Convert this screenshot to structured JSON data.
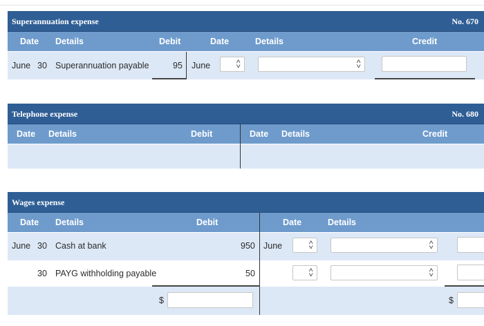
{
  "accounts": [
    {
      "title": "Superannuation expense",
      "number": "No. 670",
      "headers": {
        "date": "Date",
        "details": "Details",
        "debit": "Debit",
        "date2": "Date",
        "details2": "Details",
        "credit": "Credit"
      },
      "rows": [
        {
          "month": "June",
          "day": "30",
          "details": "Superannuation payable",
          "debit": "95",
          "credit_month": "June"
        }
      ]
    },
    {
      "title": "Telephone expense",
      "number": "No. 680",
      "headers": {
        "date": "Date",
        "details": "Details",
        "debit": "Debit",
        "date2": "Date",
        "details2": "Details",
        "credit": "Credit"
      },
      "rows": []
    },
    {
      "title": "Wages expense",
      "number": "",
      "headers": {
        "date": "Date",
        "details": "Details",
        "debit": "Debit",
        "date2": "Date",
        "details2": "Details"
      },
      "rows": [
        {
          "month": "June",
          "day": "30",
          "details": "Cash at bank",
          "debit": "950",
          "credit_month": "June"
        },
        {
          "month": "",
          "day": "30",
          "details": "PAYG withholding payable",
          "debit": "50",
          "credit_month": ""
        }
      ],
      "total_currency": "$"
    }
  ]
}
